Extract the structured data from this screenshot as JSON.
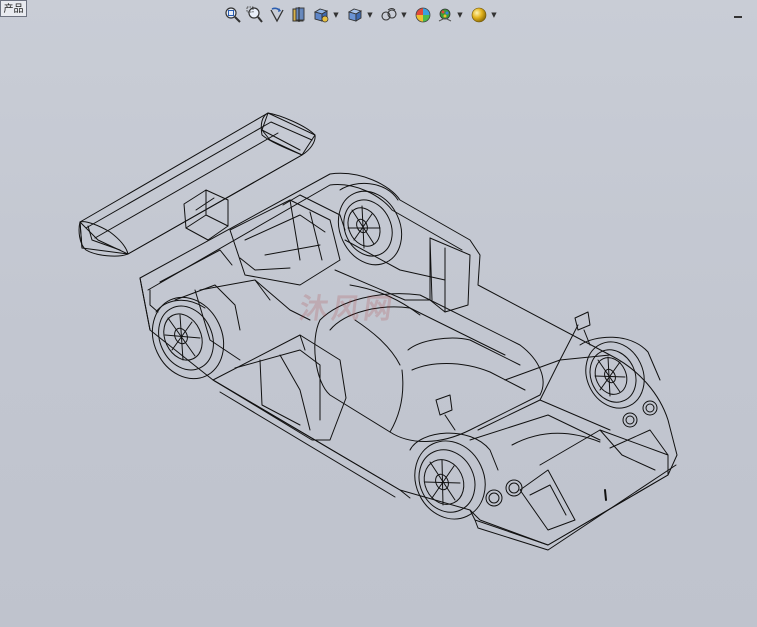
{
  "feature_tree": {
    "tab_label": "产品"
  },
  "heads_up_toolbar": {
    "items": [
      {
        "icon": "zoom-to-fit-icon",
        "dropdown": false
      },
      {
        "icon": "zoom-to-area-icon",
        "dropdown": false
      },
      {
        "icon": "previous-view-icon",
        "dropdown": false
      },
      {
        "icon": "section-view-icon",
        "dropdown": false
      },
      {
        "icon": "dynamic-annotation-icon",
        "dropdown": true
      },
      {
        "icon": "view-orientation-icon",
        "dropdown": true
      },
      {
        "icon": "display-style-icon",
        "dropdown": true
      },
      {
        "icon": "hide-show-items-icon",
        "dropdown": true
      },
      {
        "icon": "edit-appearance-icon",
        "dropdown": false
      },
      {
        "icon": "apply-scene-icon",
        "dropdown": true
      },
      {
        "icon": "view-settings-icon",
        "dropdown": true
      }
    ]
  },
  "viewport": {
    "model": "race-car-wireframe",
    "display_style": "wireframe",
    "background": "#c6cad3",
    "line_color": "#111111"
  },
  "watermark": {
    "text": "沐风网"
  },
  "window_controls": {
    "minimize": "minimize-icon"
  }
}
